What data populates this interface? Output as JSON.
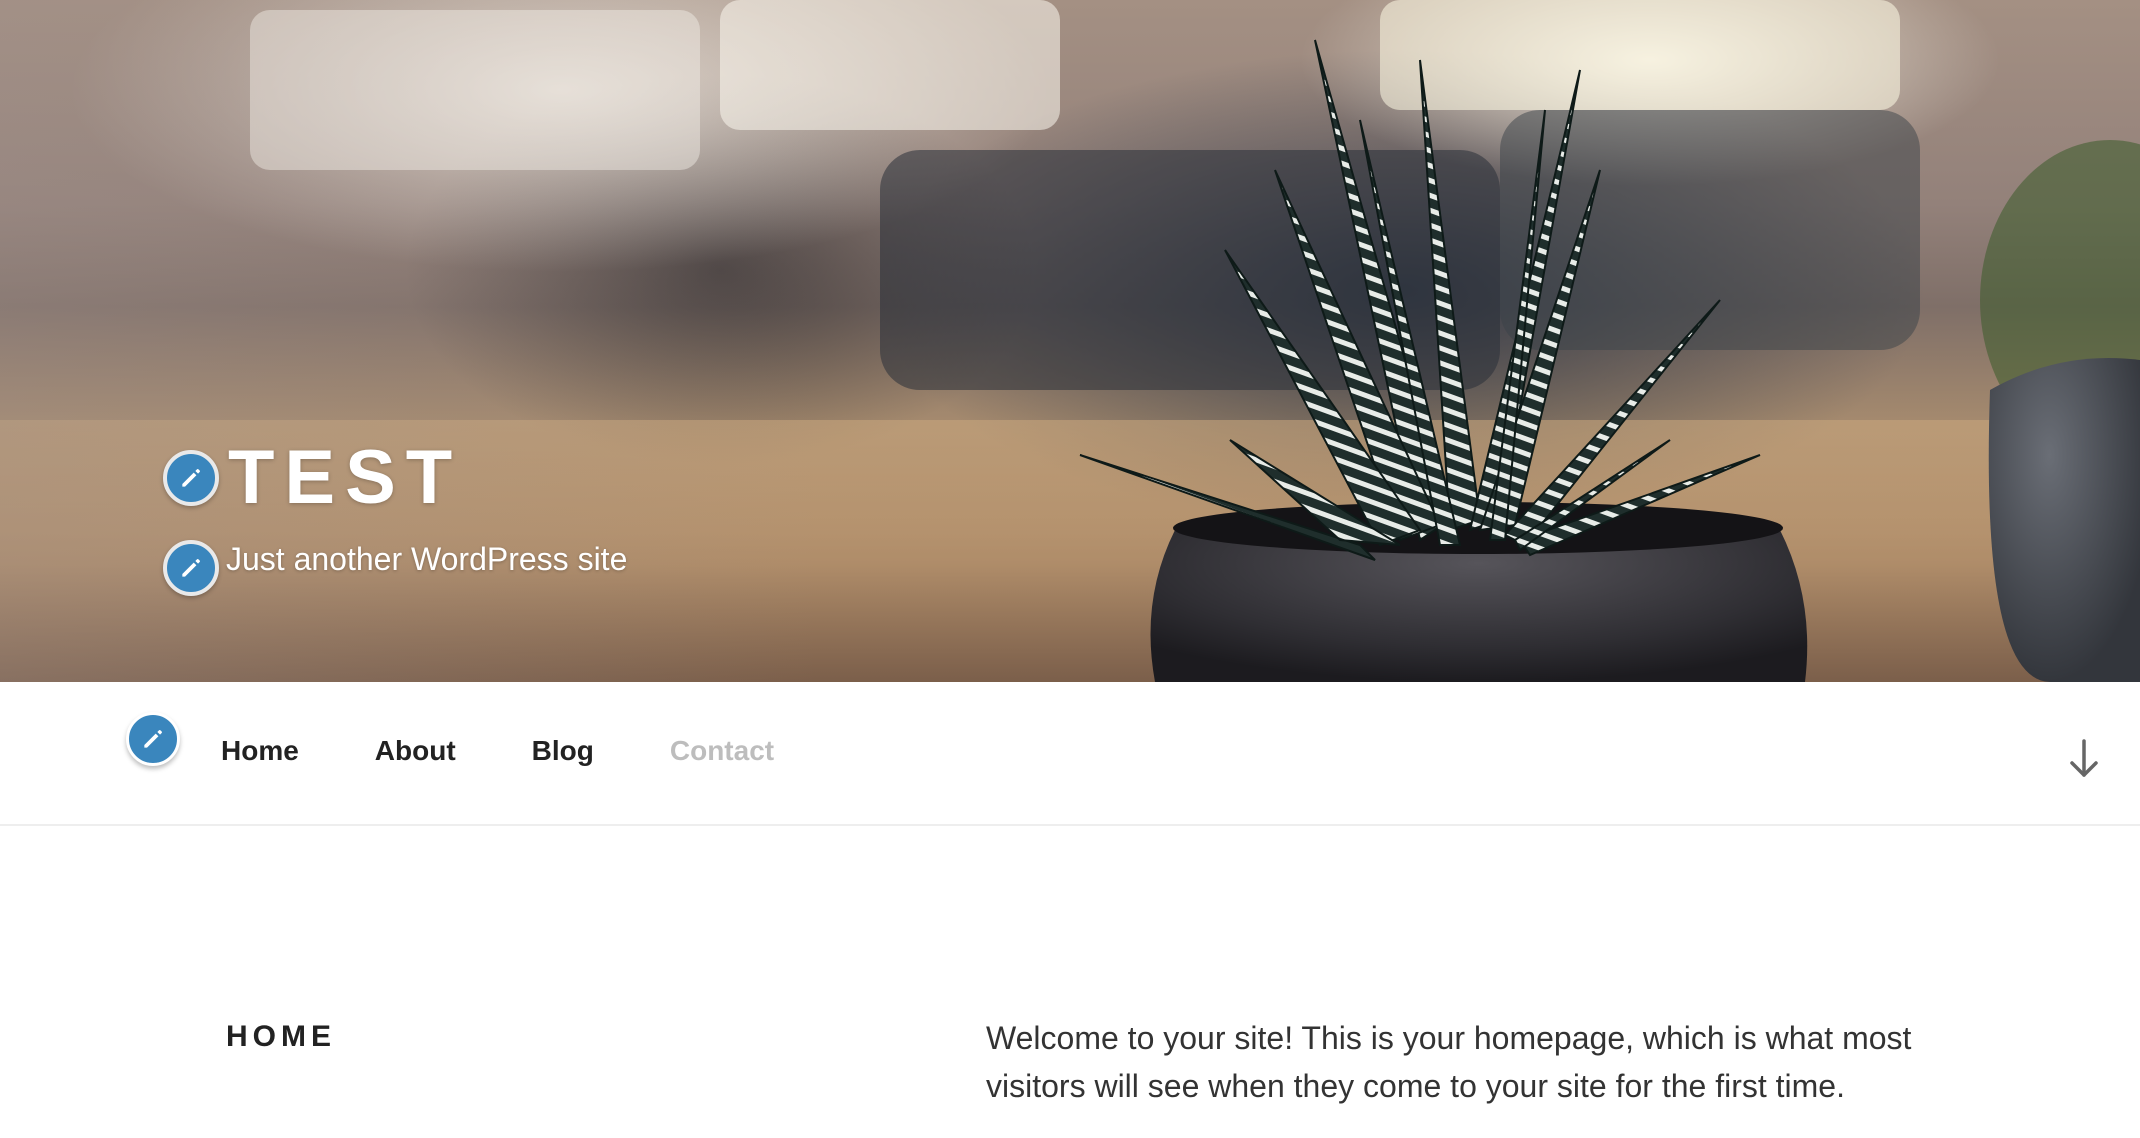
{
  "header": {
    "site_title": "TEST",
    "tagline": "Just another WordPress site",
    "background_image": "blurred room with potted zebra haworthia succulent on wooden table"
  },
  "navigation": {
    "items": [
      {
        "label": "Home"
      },
      {
        "label": "About"
      },
      {
        "label": "Blog"
      },
      {
        "label": "Contact"
      }
    ]
  },
  "page": {
    "heading": "HOME",
    "body": "Welcome to your site! This is your homepage, which is what most visitors will see when they come to your site for the first time."
  },
  "icons": {
    "edit": "pencil-edit-icon",
    "scroll": "arrow-down-icon"
  },
  "colors": {
    "accent": "#3a86bd",
    "nav_text": "#222222",
    "nav_muted": "#bdbdbd",
    "body_text": "#333333"
  }
}
